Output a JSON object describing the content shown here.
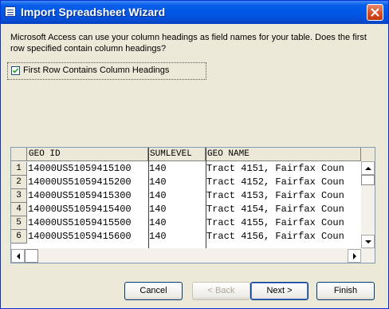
{
  "window": {
    "title": "Import Spreadsheet Wizard"
  },
  "description": "Microsoft Access can use your column headings as field names for your table. Does the first row specified contain column headings?",
  "checkbox": {
    "label": "First Row Contains Column Headings",
    "checked": true
  },
  "grid": {
    "columns": [
      "GEO ID",
      "SUMLEVEL",
      "GEO NAME"
    ],
    "rows": [
      {
        "num": "1",
        "cells": [
          "14000US51059415100",
          "140",
          "Tract 4151, Fairfax Coun"
        ]
      },
      {
        "num": "2",
        "cells": [
          "14000US51059415200",
          "140",
          "Tract 4152, Fairfax Coun"
        ]
      },
      {
        "num": "3",
        "cells": [
          "14000US51059415300",
          "140",
          "Tract 4153, Fairfax Coun"
        ]
      },
      {
        "num": "4",
        "cells": [
          "14000US51059415400",
          "140",
          "Tract 4154, Fairfax Coun"
        ]
      },
      {
        "num": "5",
        "cells": [
          "14000US51059415500",
          "140",
          "Tract 4155, Fairfax Coun"
        ]
      },
      {
        "num": "6",
        "cells": [
          "14000US51059415600",
          "140",
          "Tract 4156, Fairfax Coun"
        ]
      }
    ]
  },
  "buttons": {
    "cancel": "Cancel",
    "back": "< Back",
    "next": "Next >",
    "finish": "Finish"
  },
  "colors": {
    "title_bar": "#0058e6",
    "dialog_bg": "#ece9d8",
    "close_button": "#d84a1e"
  }
}
